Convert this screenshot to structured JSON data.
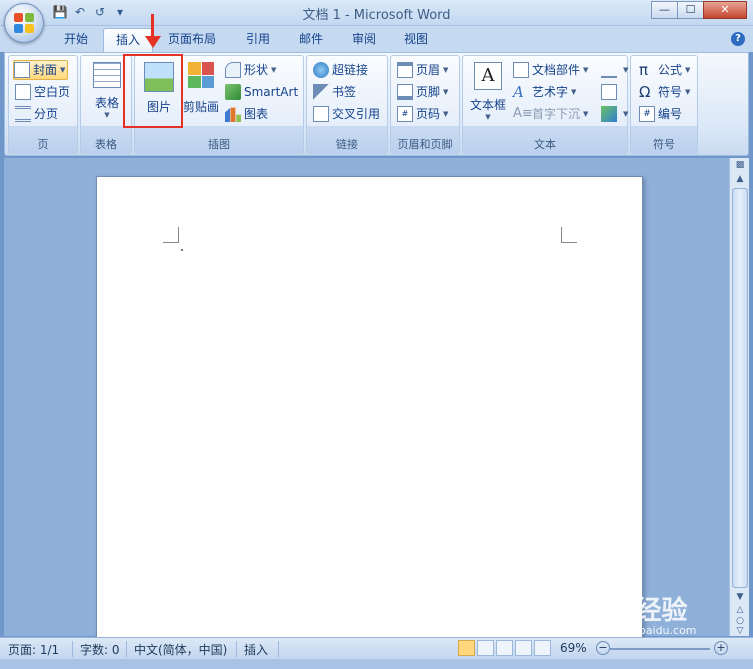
{
  "window": {
    "title": "文档 1 - Microsoft Word"
  },
  "tabs": [
    "开始",
    "插入",
    "页面布局",
    "引用",
    "邮件",
    "审阅",
    "视图"
  ],
  "active_tab": "插入",
  "ribbon": {
    "page_group": {
      "label": "页",
      "items": [
        "封面",
        "空白页",
        "分页"
      ]
    },
    "table_group": {
      "label": "表格",
      "table": "表格"
    },
    "illustrations_group": {
      "label": "插图",
      "picture": "图片",
      "clipart": "剪贴画",
      "shapes": "形状",
      "smartart": "SmartArt",
      "chart": "图表"
    },
    "links_group": {
      "label": "链接",
      "items": [
        "超链接",
        "书签",
        "交叉引用"
      ]
    },
    "header_footer_group": {
      "label": "页眉和页脚",
      "items": [
        "页眉",
        "页脚",
        "页码"
      ]
    },
    "text_group": {
      "label": "文本",
      "textbox": "文本框",
      "items": [
        "文档部件",
        "艺术字",
        "首字下沉"
      ]
    },
    "symbols_group": {
      "label": "符号",
      "items": [
        "公式",
        "符号",
        "编号"
      ]
    }
  },
  "statusbar": {
    "page": "页面: 1/1",
    "words": "字数: 0",
    "language": "中文(简体，中国)",
    "mode": "插入",
    "zoom": "69%"
  },
  "watermark": {
    "main": "Bai 经验",
    "sub": "jingyan.baidu.com"
  },
  "colors": {
    "accent": "#15428b",
    "highlight": "#e53224",
    "ribbon_bg": "#dde9f8"
  }
}
